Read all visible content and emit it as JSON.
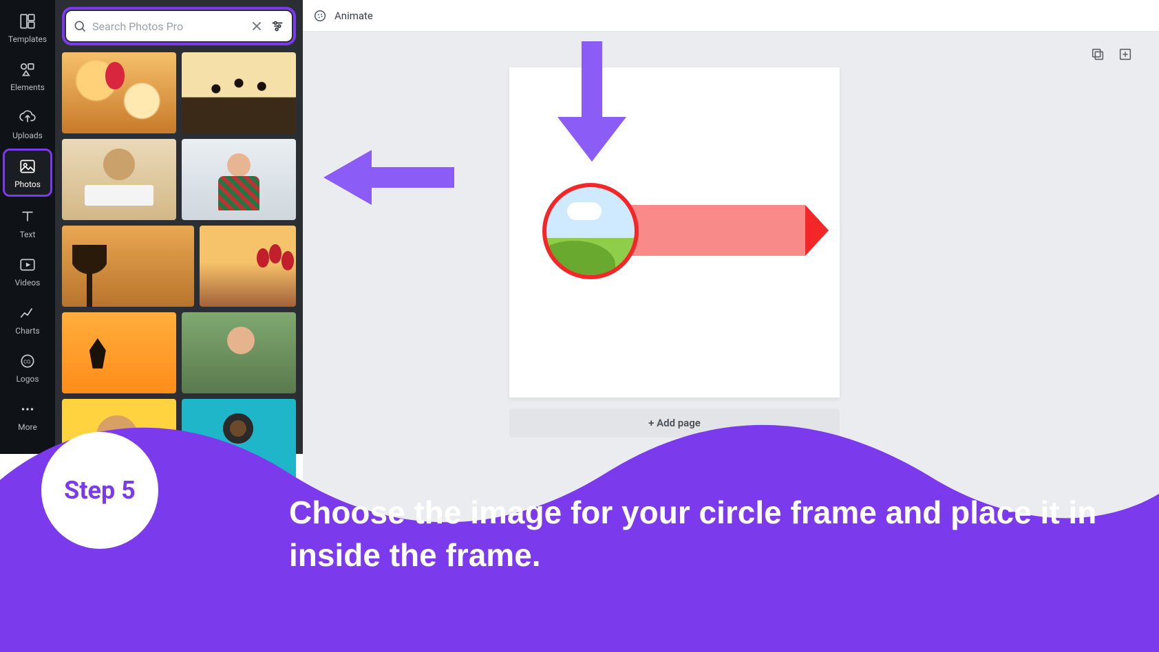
{
  "rail": {
    "items": [
      {
        "id": "templates",
        "label": "Templates"
      },
      {
        "id": "elements",
        "label": "Elements"
      },
      {
        "id": "uploads",
        "label": "Uploads"
      },
      {
        "id": "photos",
        "label": "Photos"
      },
      {
        "id": "text",
        "label": "Text"
      },
      {
        "id": "videos",
        "label": "Videos"
      },
      {
        "id": "charts",
        "label": "Charts"
      },
      {
        "id": "logos",
        "label": "Logos"
      },
      {
        "id": "more",
        "label": "More"
      }
    ],
    "active": "photos"
  },
  "search": {
    "placeholder": "Search Photos Pro",
    "value": ""
  },
  "toolbar": {
    "animate_label": "Animate"
  },
  "add_page_label": "+ Add page",
  "step": {
    "badge": "Step 5",
    "text": "Choose the image for your circle frame and place it in inside the frame."
  },
  "colors": {
    "purple": "#7c3aed",
    "purple_light": "#8b5cf6",
    "frame_red": "#f22828",
    "bar_pink": "#f88a8a"
  }
}
